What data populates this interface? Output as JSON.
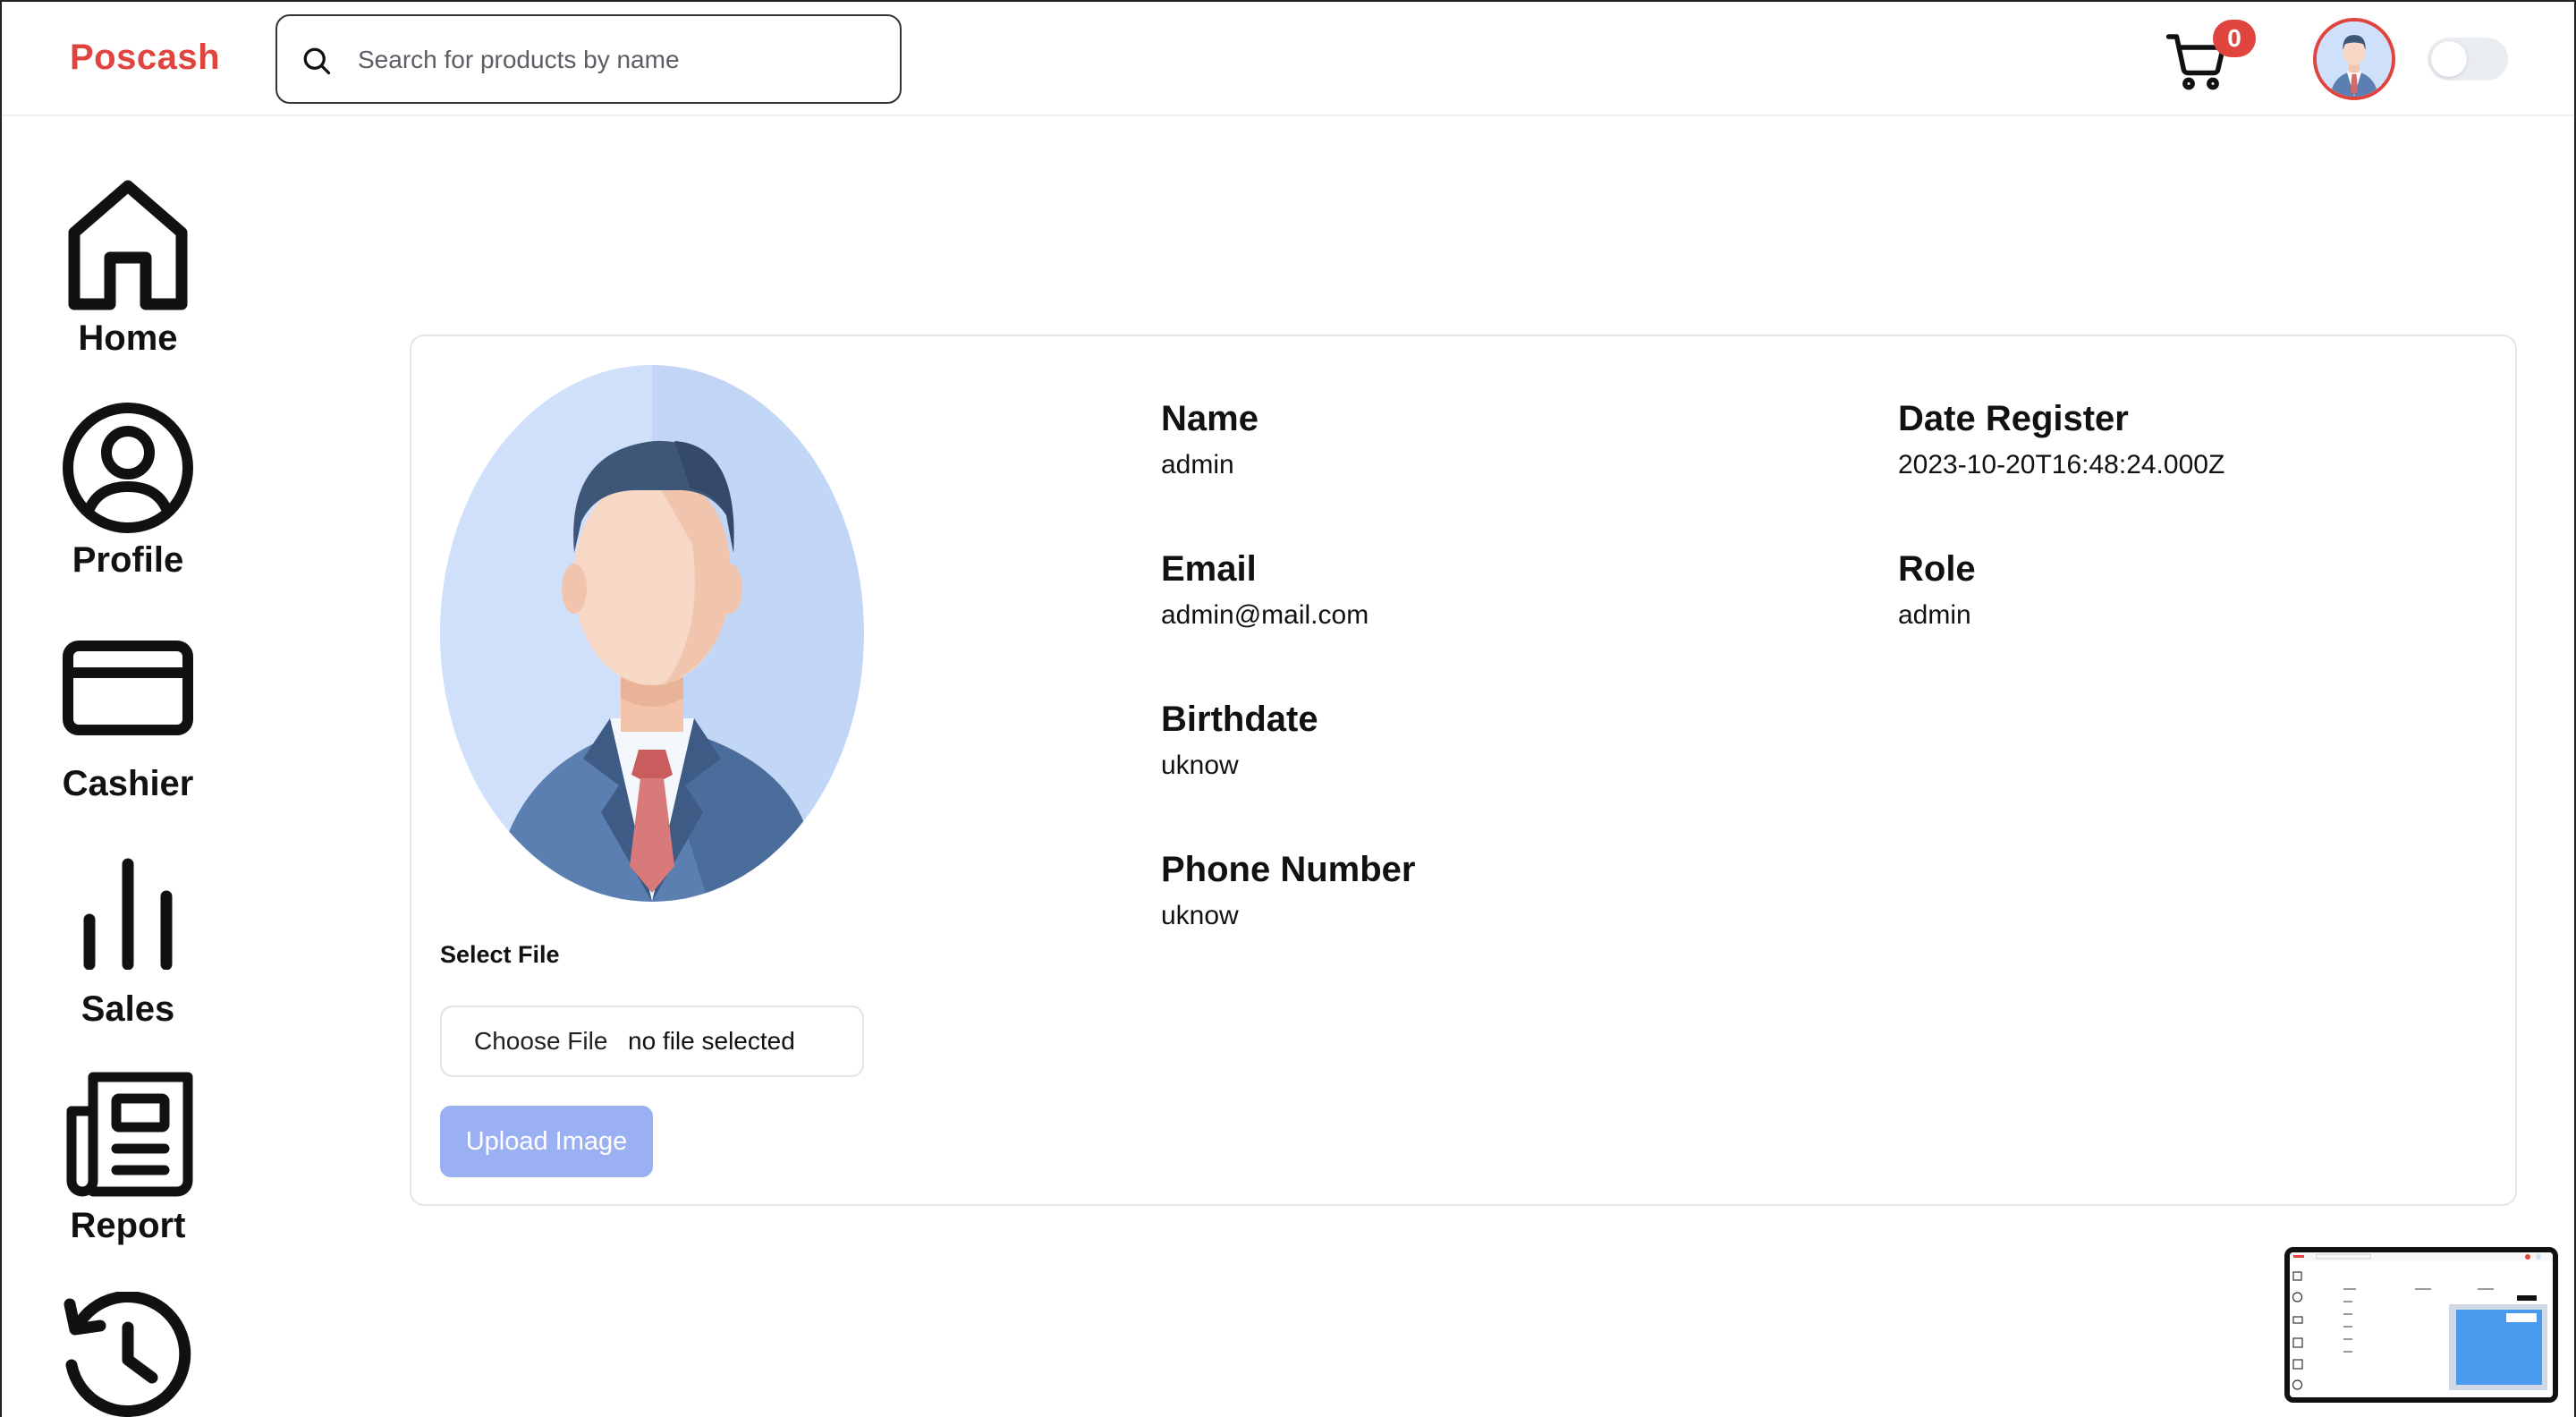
{
  "brand": {
    "name": "Poscash",
    "color": "#e0443e"
  },
  "search": {
    "placeholder": "Search for products by name",
    "value": "",
    "icon": "search-icon"
  },
  "cart": {
    "icon": "cart-icon",
    "count": "0"
  },
  "user": {
    "avatar": "avatar-businessman"
  },
  "theme_toggle": {
    "state": "off"
  },
  "sidebar": {
    "items": [
      {
        "label": "Home",
        "icon": "home-icon"
      },
      {
        "label": "Profile",
        "icon": "user-circle-icon"
      },
      {
        "label": "Cashier",
        "icon": "credit-card-icon"
      },
      {
        "label": "Sales",
        "icon": "bar-chart-icon"
      },
      {
        "label": "Report",
        "icon": "newspaper-icon"
      },
      {
        "label": "",
        "icon": "history-icon"
      }
    ]
  },
  "profile": {
    "photo": "businessman-avatar",
    "file": {
      "label": "Select File",
      "button": "Choose File",
      "status": "no file selected"
    },
    "upload_button": "Upload Image",
    "fields": {
      "name": {
        "label": "Name",
        "value": "admin"
      },
      "email": {
        "label": "Email",
        "value": "admin@mail.com"
      },
      "birthdate": {
        "label": "Birthdate",
        "value": "uknow"
      },
      "phone": {
        "label": "Phone Number",
        "value": "uknow"
      },
      "date_register": {
        "label": "Date Register",
        "value": "2023-10-20T16:48:24.000Z"
      },
      "role": {
        "label": "Role",
        "value": "admin"
      }
    }
  },
  "colors": {
    "accent": "#e0443e",
    "upload_button": "#9bb0f2"
  }
}
